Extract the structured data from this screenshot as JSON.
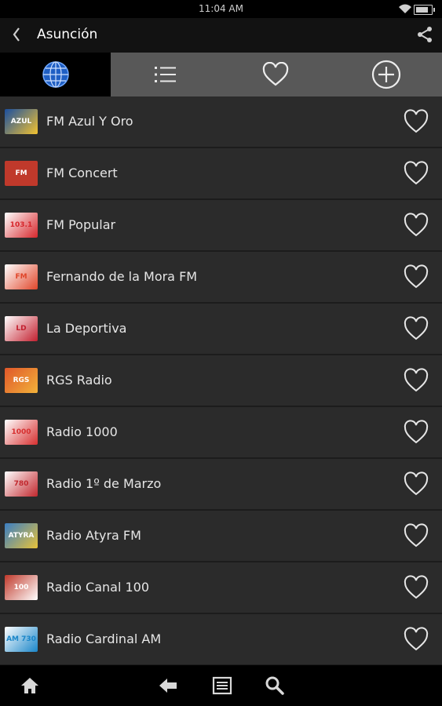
{
  "status_bar": {
    "time": "11:04 AM",
    "battery_level": 0.85
  },
  "action_bar": {
    "title": "Asunción"
  },
  "tabs": [
    {
      "name": "world",
      "icon": "globe-icon",
      "active": true
    },
    {
      "name": "list",
      "icon": "list-icon",
      "active": false
    },
    {
      "name": "favorites",
      "icon": "heart-icon",
      "active": false
    },
    {
      "name": "add",
      "icon": "plus-circle-icon",
      "active": false
    }
  ],
  "stations": [
    {
      "name": "FM Azul Y Oro",
      "logo_text": "AZUL",
      "logo_colors": [
        "#1a4fa0",
        "#f2c230"
      ]
    },
    {
      "name": "FM Concert",
      "logo_text": "FM",
      "logo_colors": [
        "#c0392b",
        "#c0392b"
      ]
    },
    {
      "name": "FM Popular",
      "logo_text": "103.1",
      "logo_colors": [
        "#ffffff",
        "#d7262b"
      ]
    },
    {
      "name": "Fernando de la Mora FM",
      "logo_text": "FM",
      "logo_colors": [
        "#ffffff",
        "#e0462a"
      ]
    },
    {
      "name": "La Deportiva",
      "logo_text": "LD",
      "logo_colors": [
        "#ffffff",
        "#c3202f"
      ]
    },
    {
      "name": "RGS Radio",
      "logo_text": "RGS",
      "logo_colors": [
        "#e0572a",
        "#f2b23a"
      ]
    },
    {
      "name": "Radio 1000",
      "logo_text": "1000",
      "logo_colors": [
        "#ffffff",
        "#d72f2f"
      ]
    },
    {
      "name": "Radio 1º de Marzo",
      "logo_text": "780",
      "logo_colors": [
        "#ffffff",
        "#c1272d"
      ]
    },
    {
      "name": "Radio Atyra FM",
      "logo_text": "ATYRA",
      "logo_colors": [
        "#3a7ec4",
        "#e7c23a"
      ]
    },
    {
      "name": "Radio Canal 100",
      "logo_text": "100",
      "logo_colors": [
        "#c0392b",
        "#ffffff"
      ]
    },
    {
      "name": "Radio Cardinal AM",
      "logo_text": "AM 730",
      "logo_colors": [
        "#ffffff",
        "#1a86c9"
      ]
    }
  ],
  "nav_bar": {
    "buttons": [
      "home-icon",
      "back-arrow-icon",
      "menu-icon",
      "search-icon"
    ]
  }
}
